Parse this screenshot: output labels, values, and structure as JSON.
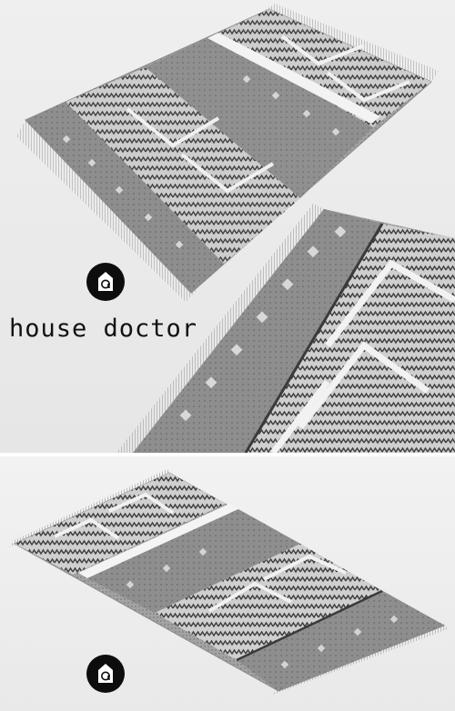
{
  "brand": {
    "name": "house doctor",
    "logo_icon": "house-bag-icon",
    "logo_color": "#0d0d0d"
  },
  "colors": {
    "rug_base": "#9a9a9a",
    "rug_dark": "#4a4a4a",
    "rug_light": "#e4e4e4",
    "fringe": "#cfcfcf",
    "background": "#ebebeb"
  }
}
